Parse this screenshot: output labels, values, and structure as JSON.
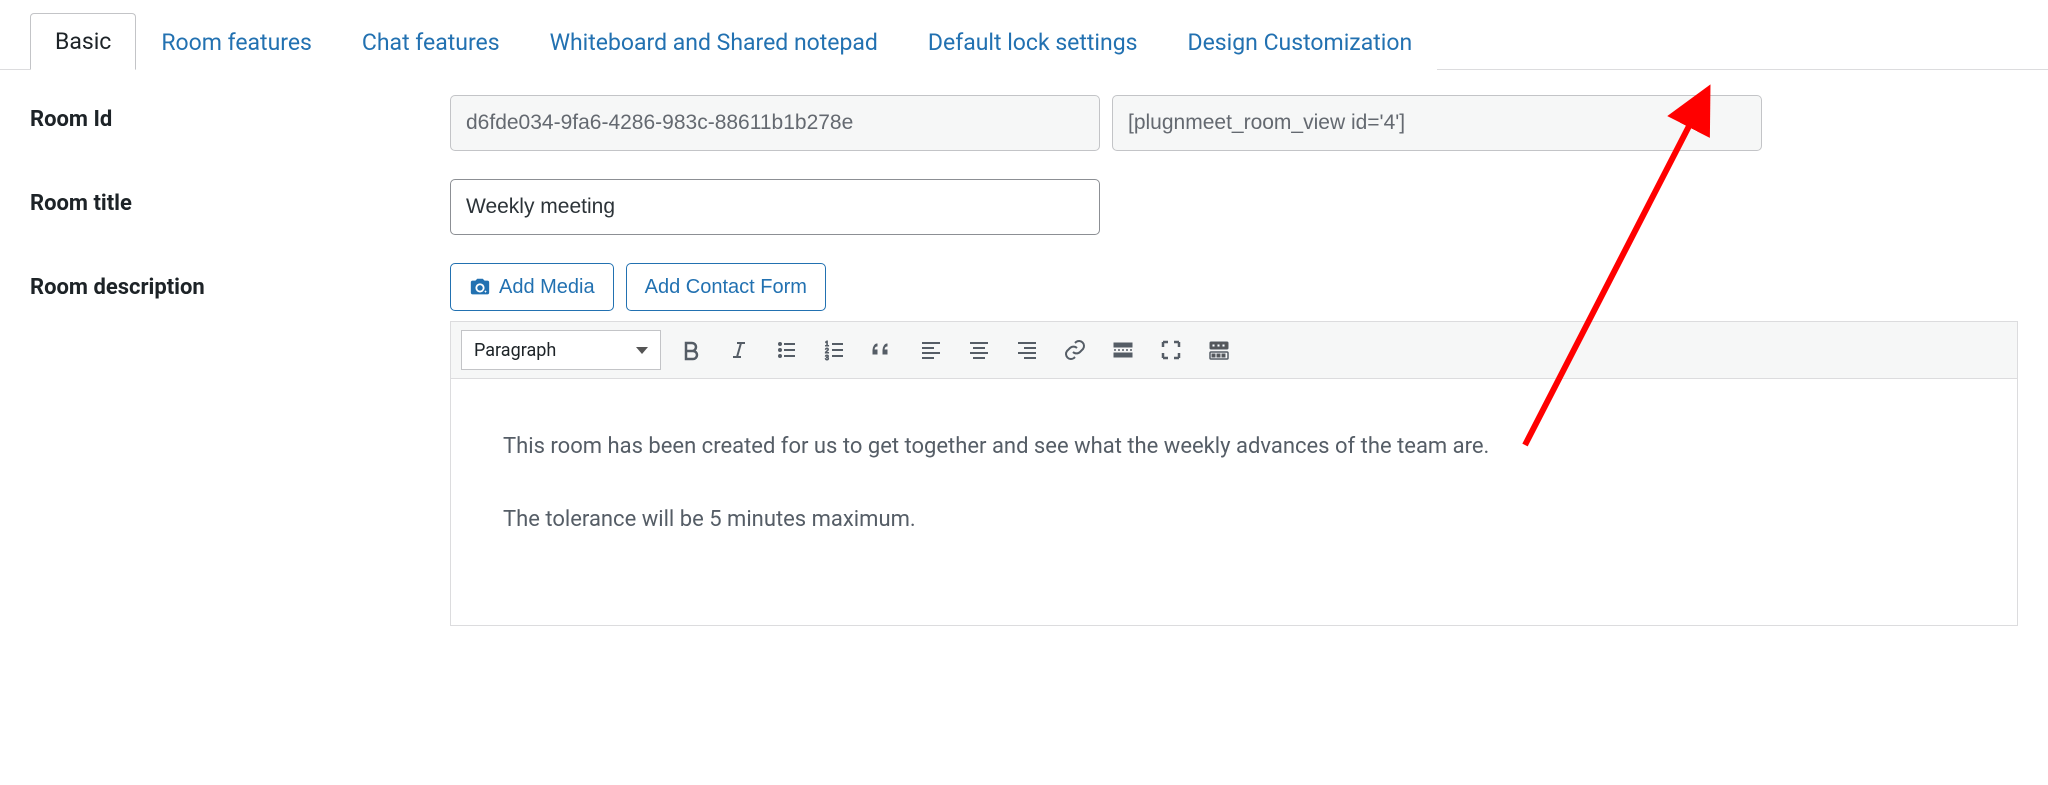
{
  "tabs": [
    {
      "label": "Basic",
      "active": true
    },
    {
      "label": "Room features",
      "active": false
    },
    {
      "label": "Chat features",
      "active": false
    },
    {
      "label": "Whiteboard and Shared notepad",
      "active": false
    },
    {
      "label": "Default lock settings",
      "active": false
    },
    {
      "label": "Design Customization",
      "active": false
    }
  ],
  "fields": {
    "room_id": {
      "label": "Room Id",
      "value": "d6fde034-9fa6-4286-983c-88611b1b278e",
      "shortcode": "[plugnmeet_room_view id='4']"
    },
    "room_title": {
      "label": "Room title",
      "value": "Weekly meeting"
    },
    "room_description": {
      "label": "Room description"
    }
  },
  "buttons": {
    "add_media": "Add Media",
    "add_contact_form": "Add Contact Form"
  },
  "editor": {
    "format": "Paragraph",
    "paragraph1": "This room has been created for us to get together and see what the weekly advances of the team are.",
    "paragraph2": "The tolerance will be 5 minutes maximum."
  }
}
